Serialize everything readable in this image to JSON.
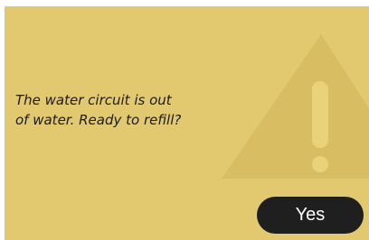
{
  "dialog": {
    "message": "The water circuit is out\nof water. Ready to refill?",
    "icon": "warning-triangle-icon",
    "yes_label": "Yes"
  },
  "colors": {
    "background": "#e2c86f",
    "triangle": "#d9bd62",
    "exclamation": "#ead27a",
    "button": "#1f1f1f",
    "button_text": "#ffffff",
    "text": "#1c1c1c"
  }
}
